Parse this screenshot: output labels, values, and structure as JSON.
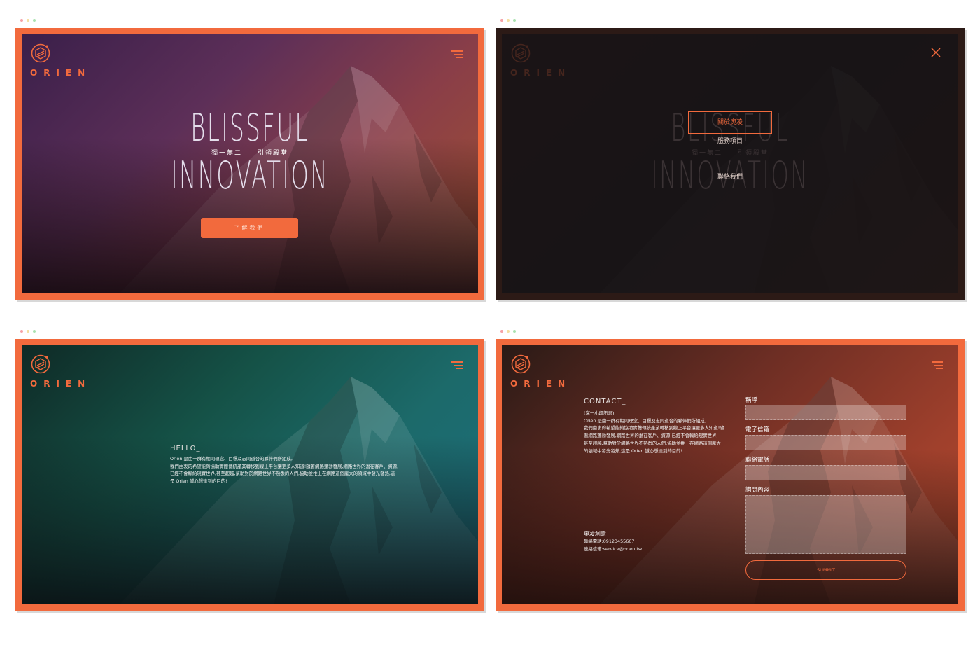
{
  "brand": {
    "name": "ORIEN",
    "accent": "#f26a3d"
  },
  "home": {
    "title_top": "BLISSFUL",
    "title_bottom": "INNOVATION",
    "subtitle": "獨一無二　　引領殿堂",
    "cta_label": "了解我們"
  },
  "menu": {
    "items": [
      {
        "label": "關於奧凌",
        "active": true
      },
      {
        "label": "服務項目",
        "active": false
      },
      {
        "label": "聯絡我們",
        "active": false
      }
    ]
  },
  "hello": {
    "title": "HELLO_",
    "lines": [
      "Orien 是由一群有相同理念、目標及志同道合的夥伴們所組成,",
      "我們由衷的希望能夠協助實體傳統產業轉移到線上平台讓更多人知道!隨著網路蓬勃發展,網路世界的潛在客戶、資源,",
      "已經不會輸給現實世界,甚至超越,幫助對於網路世界不熟悉的人們,協助並推上在網路這個龐大的領域中發光發熱,這",
      "是 Orien 誠心想達到的目的!"
    ]
  },
  "contact": {
    "title": "CONTACT_",
    "lead": "(寫一小段訊息)",
    "lines": [
      "Orien 是由一群有相同理念、目標及志同道合的夥伴們所組成,",
      "我們由衷的希望能夠協助實體傳統產業轉移到線上平台讓更多人知道!隨",
      "著網路蓬勃發展,網路世界的潛在客戶、資源,已經不會輸給現實世界,",
      "甚至超越,幫助對於網路世界不熟悉的人們,協助並推上在網路這個龐大",
      "的領域中發光發熱,這是 Orien 誠心想達到的目的!"
    ],
    "company": "奧凌創意",
    "phone": "聯絡電話:09123455667",
    "email": "連絡信箱:service@orien.tw",
    "form": {
      "name_label": "稱呼",
      "email_label": "電子信箱",
      "phone_label": "聯絡電話",
      "message_label": "詢問內容",
      "submit_label": "SUMMIT"
    }
  }
}
